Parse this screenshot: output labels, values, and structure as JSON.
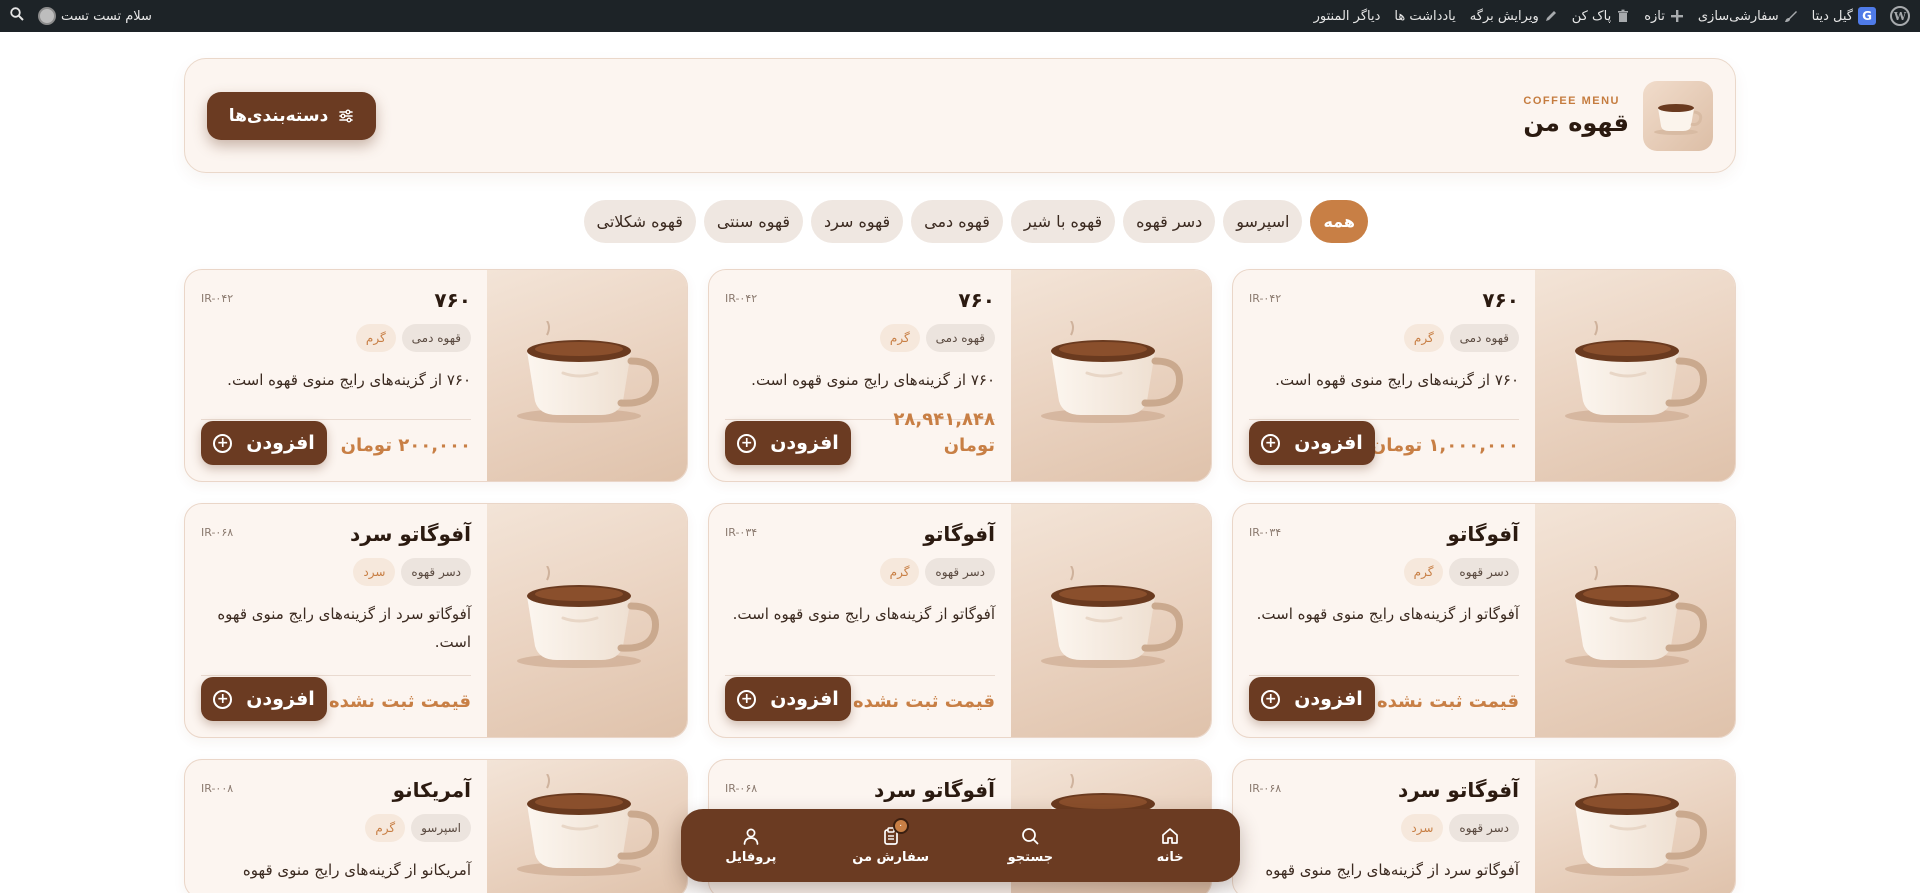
{
  "admin_bar": {
    "greeting": "سلام تست تست",
    "items": [
      "دیاگر المنتور",
      "یادداشت ها",
      "ویرایش برگه",
      "پاک کن",
      "تازه",
      "سفارشی‌سازی",
      "گیل دیتا"
    ],
    "g_letter": "G",
    "wp_letter": "W"
  },
  "header": {
    "subtitle": "COFFEE MENU",
    "title": "قهوه من",
    "categories_button": "دسته‌بندی‌ها"
  },
  "chips": [
    "همه",
    "اسپرسو",
    "دسر قهوه",
    "قهوه با شیر",
    "قهوه دمی",
    "قهوه سرد",
    "قهوه سنتی",
    "قهوه شکلاتی"
  ],
  "add_label": "افزودن",
  "cards": [
    {
      "title": "۷۶۰",
      "code": "IR-۰۴۲",
      "tags": [
        "قهوه دمی",
        "گرم"
      ],
      "desc": "۷۶۰ از گزینه‌های رایج منوی قهوه است.",
      "price": "۱,۰۰۰,۰۰۰ تومان"
    },
    {
      "title": "۷۶۰",
      "code": "IR-۰۴۲",
      "tags": [
        "قهوه دمی",
        "گرم"
      ],
      "desc": "۷۶۰ از گزینه‌های رایج منوی قهوه است.",
      "price": "۲۸,۹۴۱,۸۴۸ تومان"
    },
    {
      "title": "۷۶۰",
      "code": "IR-۰۴۲",
      "tags": [
        "قهوه دمی",
        "گرم"
      ],
      "desc": "۷۶۰ از گزینه‌های رایج منوی قهوه است.",
      "price": "۲۰۰,۰۰۰ تومان"
    },
    {
      "title": "آفوگاتو",
      "code": "IR-۰۳۴",
      "tags": [
        "دسر قهوه",
        "گرم"
      ],
      "desc": "آفوگاتو از گزینه‌های رایج منوی قهوه است.",
      "price": "قیمت ثبت نشده"
    },
    {
      "title": "آفوگاتو",
      "code": "IR-۰۳۴",
      "tags": [
        "دسر قهوه",
        "گرم"
      ],
      "desc": "آفوگاتو از گزینه‌های رایج منوی قهوه است.",
      "price": "قیمت ثبت نشده"
    },
    {
      "title": "آفوگاتو سرد",
      "code": "IR-۰۶۸",
      "tags": [
        "دسر قهوه",
        "سرد"
      ],
      "desc": "آفوگاتو سرد از گزینه‌های رایج منوی قهوه است.",
      "price": "قیمت ثبت نشده"
    },
    {
      "title": "آفوگاتو سرد",
      "code": "IR-۰۶۸",
      "tags": [
        "دسر قهوه",
        "سرد"
      ],
      "desc": "آفوگاتو سرد از گزینه‌های رایج منوی قهوه",
      "price": ""
    },
    {
      "title": "آفوگاتو سرد",
      "code": "IR-۰۶۸",
      "tags": [],
      "desc": "",
      "price": ""
    },
    {
      "title": "آمریکانو",
      "code": "IR-۰۰۸",
      "tags": [
        "اسپرسو",
        "گرم"
      ],
      "desc": "آمریکانو از گزینه‌های رایج منوی قهوه",
      "price": ""
    }
  ],
  "bottom_nav": [
    {
      "label": "خانه",
      "icon": "home-icon"
    },
    {
      "label": "جستجو",
      "icon": "search-icon"
    },
    {
      "label": "سفارش من",
      "icon": "clipboard-icon",
      "badge": "۰"
    },
    {
      "label": "پروفایل",
      "icon": "user-icon"
    }
  ],
  "colors": {
    "accent": "#c87f45",
    "brand_dark": "#6b3b22",
    "background": "#fcf5f0"
  }
}
